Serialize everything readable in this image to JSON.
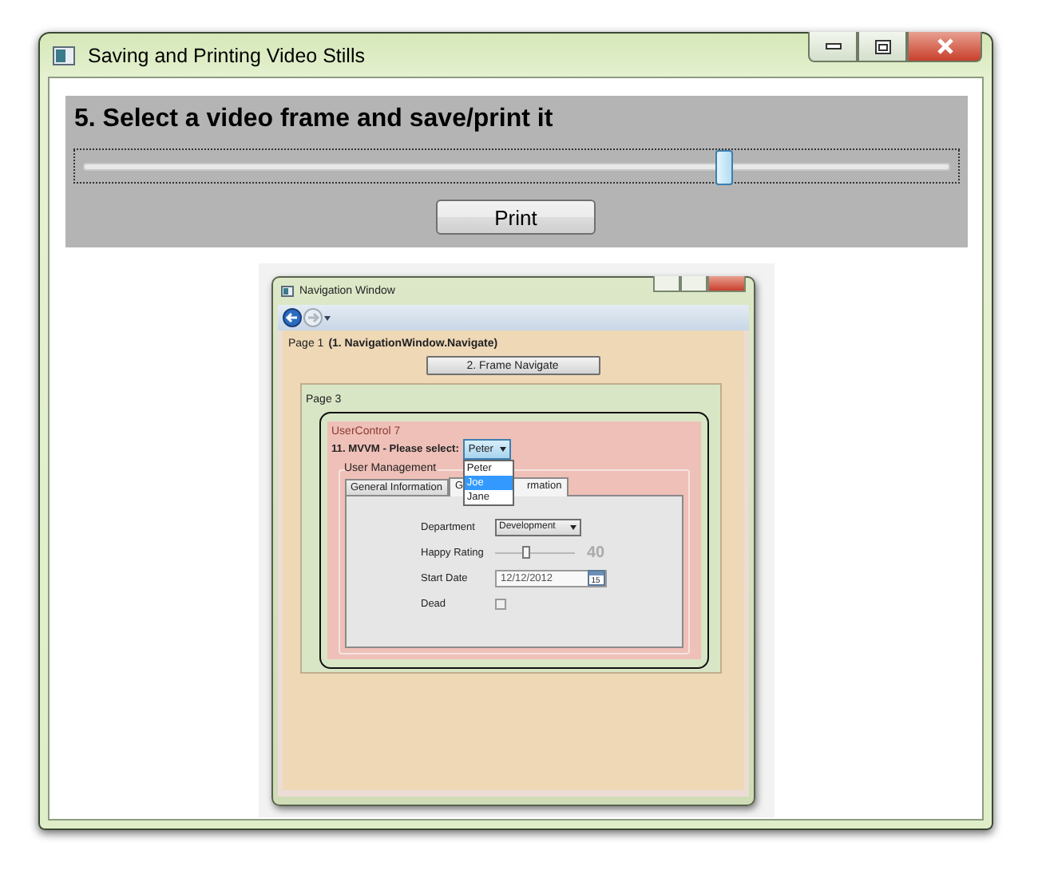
{
  "window": {
    "title": "Saving and Printing Video Stills"
  },
  "panel": {
    "heading": "5. Select a video frame and save/print it",
    "slider": {
      "level": 0.74
    },
    "print_button": "Print"
  },
  "video_frame": {
    "window_title": "Navigation Window",
    "page1_label": "Page 1",
    "page1_note": "(1. NavigationWindow.Navigate)",
    "frame_button": "2. Frame Navigate",
    "page3_label": "Page 3",
    "usercontrol_label": "UserControl 7",
    "select_label": "11. MVVM - Please select:",
    "combo_value": "Peter",
    "dropdown": [
      {
        "label": "Peter",
        "selected": false
      },
      {
        "label": "Joe",
        "selected": true
      },
      {
        "label": "Jane",
        "selected": false
      }
    ],
    "group_title": "User Management",
    "tabs": [
      {
        "label_start": "General Information",
        "selected": false
      },
      {
        "label_start": "G",
        "label_end": "rmation",
        "selected": true
      }
    ],
    "fields": [
      {
        "kind": "combo",
        "label": "Department",
        "value": "Development"
      },
      {
        "kind": "slider",
        "label": "Happy Rating",
        "level": 0.4,
        "reading": "40"
      },
      {
        "kind": "date",
        "label": "Start Date",
        "value": "12/12/2012",
        "calendar_day": "15"
      },
      {
        "kind": "checkbox",
        "label": "Dead",
        "checked": false
      }
    ]
  }
}
